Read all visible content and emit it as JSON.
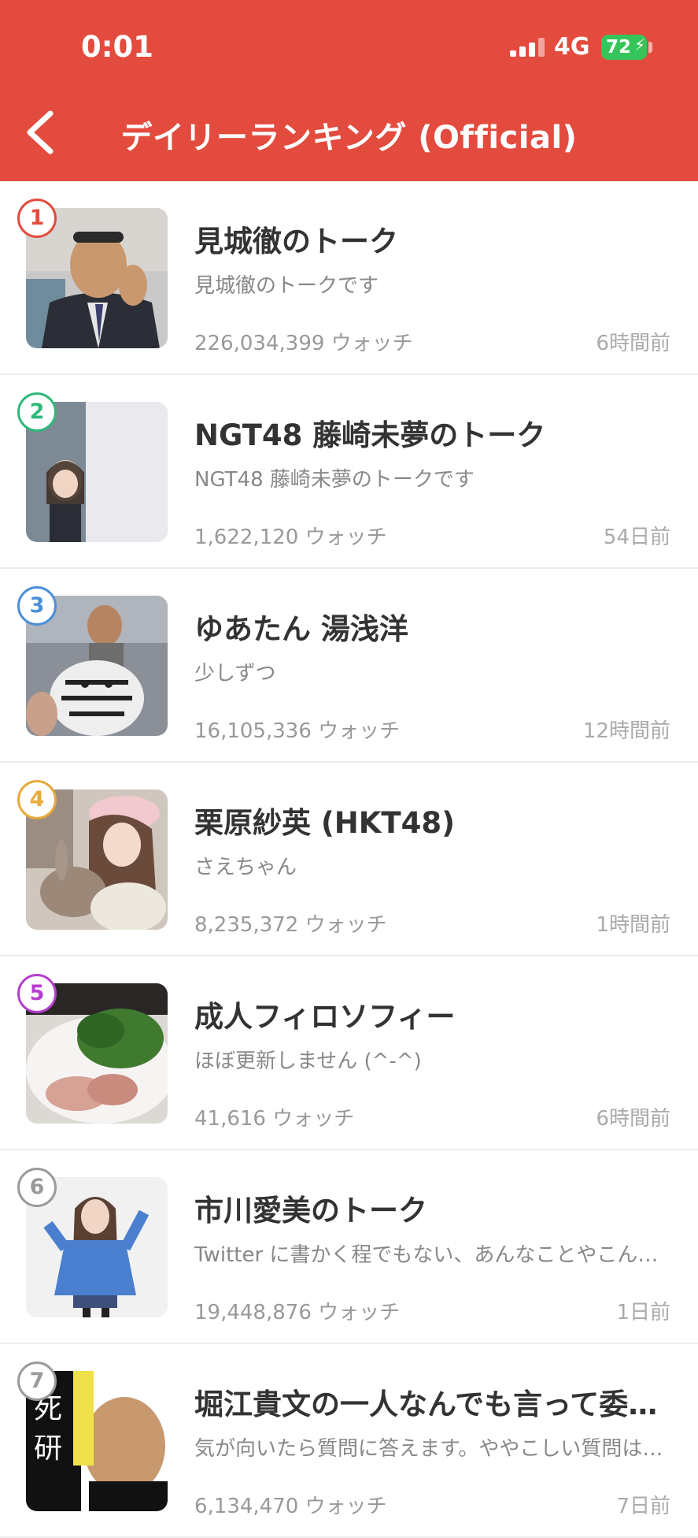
{
  "status_bar": {
    "time": "0:01",
    "network": "4G",
    "battery": "72"
  },
  "header": {
    "title": "デイリーランキング (Official)"
  },
  "colors": {
    "header": "#e34b3e",
    "rank1": "#e34b3e",
    "rank2": "#2fb87a",
    "rank3": "#4a8fd8",
    "rank4": "#e9a93a",
    "rank5": "#b53fcf",
    "rank6": "#9a9a9a"
  },
  "icons": {
    "back": "chevron-left-icon",
    "signal": "signal-bars-icon",
    "battery": "battery-charging-icon"
  },
  "rankings": [
    {
      "rank": "1",
      "name": "見城徹のトーク",
      "description": "見城徹のトークです",
      "watch": "226,034,399 ウォッチ",
      "time": "6時間前"
    },
    {
      "rank": "2",
      "name": "NGT48 藤崎未夢のトーク",
      "description": "NGT48 藤崎未夢のトークです",
      "watch": "1,622,120 ウォッチ",
      "time": "54日前"
    },
    {
      "rank": "3",
      "name": "ゆあたん 湯浅洋",
      "description": "少しずつ",
      "watch": "16,105,336 ウォッチ",
      "time": "12時間前"
    },
    {
      "rank": "4",
      "name": "栗原紗英 (HKT48)",
      "description": "さえちゃん",
      "watch": "8,235,372 ウォッチ",
      "time": "1時間前"
    },
    {
      "rank": "5",
      "name": "成人フィロソフィー",
      "description": "ほぼ更新しません (^-^)",
      "watch": "41,616 ウォッチ",
      "time": "6時間前"
    },
    {
      "rank": "6",
      "name": "市川愛美のトーク",
      "description": "Twitter に書かく程でもない、あんなことやこんなこと",
      "watch": "19,448,876 ウォッチ",
      "time": "1日前"
    },
    {
      "rank": "7",
      "name": "堀江貴文の一人なんでも言って委員会",
      "description": "気が向いたら質問に答えます。ややこしい質問は答えません",
      "watch": "6,134,470 ウォッチ",
      "time": "7日前"
    }
  ]
}
